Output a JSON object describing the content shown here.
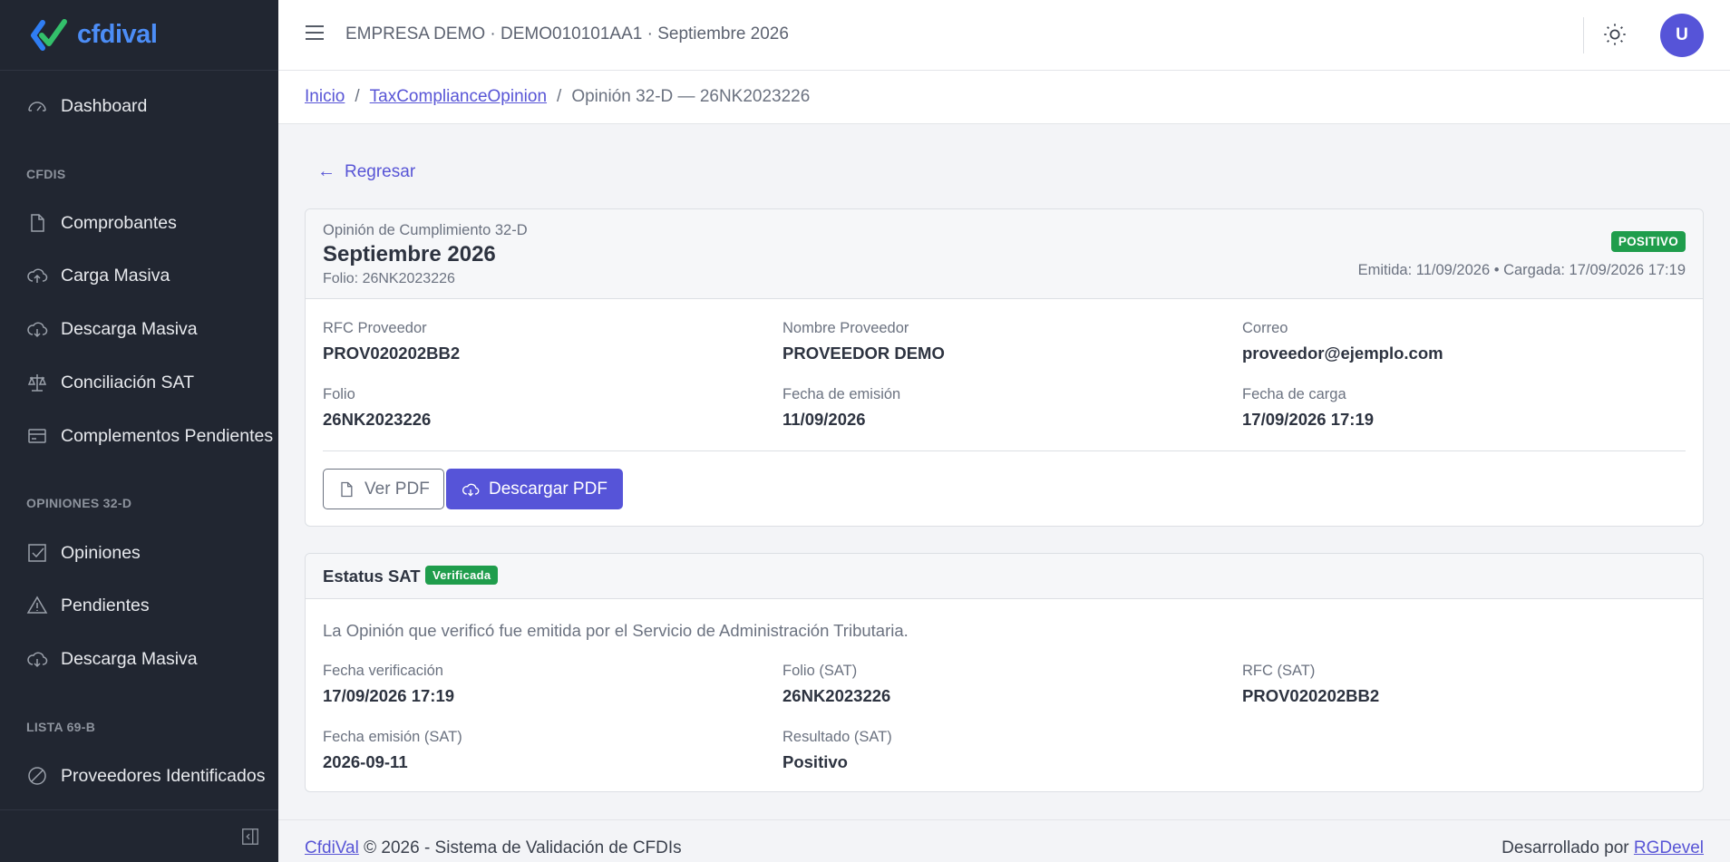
{
  "brand": {
    "name": "cfdival"
  },
  "sidebar": {
    "dashboard": "Dashboard",
    "sections": [
      {
        "title": "CFDIS",
        "items": [
          "Comprobantes",
          "Carga Masiva",
          "Descarga Masiva",
          "Conciliación SAT",
          "Complementos Pendientes"
        ]
      },
      {
        "title": "OPINIONES 32-D",
        "items": [
          "Opiniones",
          "Pendientes",
          "Descarga Masiva"
        ]
      },
      {
        "title": "LISTA 69-B",
        "items": [
          "Proveedores Identificados"
        ]
      }
    ]
  },
  "header": {
    "title": "EMPRESA DEMO · DEMO010101AA1 · Septiembre 2026",
    "avatar_initial": "U"
  },
  "breadcrumb": {
    "home": "Inicio",
    "section": "TaxComplianceOpinion",
    "separator": "/",
    "current": "Opinión 32-D — 26NK2023226"
  },
  "back": {
    "arrow": "←",
    "label": "Regresar"
  },
  "opinion": {
    "subtitle": "Opinión de Cumplimiento 32-D",
    "title": "Septiembre 2026",
    "folio_line": "Folio: 26NK2023226",
    "status_badge": "POSITIVO",
    "dates_line": "Emitida: 11/09/2026 • Cargada: 17/09/2026 17:19",
    "fields": {
      "rfc_label": "RFC Proveedor",
      "rfc_value": "PROV020202BB2",
      "nombre_label": "Nombre Proveedor",
      "nombre_value": "PROVEEDOR DEMO",
      "correo_label": "Correo",
      "correo_value": "proveedor@ejemplo.com",
      "folio_label": "Folio",
      "folio_value": "26NK2023226",
      "emision_label": "Fecha de emisión",
      "emision_value": "11/09/2026",
      "carga_label": "Fecha de carga",
      "carga_value": "17/09/2026 17:19"
    },
    "buttons": {
      "view_pdf": "Ver PDF",
      "download_pdf": "Descargar PDF"
    }
  },
  "sat_status": {
    "title": "Estatus SAT",
    "badge": "Verificada",
    "description": "La Opinión que verificó fue emitida por el Servicio de Administración Tributaria.",
    "fields": {
      "fecha_verif_label": "Fecha verificación",
      "fecha_verif_value": "17/09/2026 17:19",
      "folio_sat_label": "Folio (SAT)",
      "folio_sat_value": "26NK2023226",
      "rfc_sat_label": "RFC (SAT)",
      "rfc_sat_value": "PROV020202BB2",
      "emision_sat_label": "Fecha emisión (SAT)",
      "emision_sat_value": "2026-09-11",
      "resultado_label": "Resultado (SAT)",
      "resultado_value": "Positivo"
    }
  },
  "footer": {
    "brand_link": "CfdiVal",
    "copyright": " © 2026 - Sistema de Validación de CFDIs",
    "dev_prefix": "Desarrollado por ",
    "dev_link": "RGDevel"
  },
  "colors": {
    "primary": "#5654d8",
    "sidebar_bg": "#212631",
    "success": "#1f9d4c",
    "brand": "#4c8df6"
  }
}
